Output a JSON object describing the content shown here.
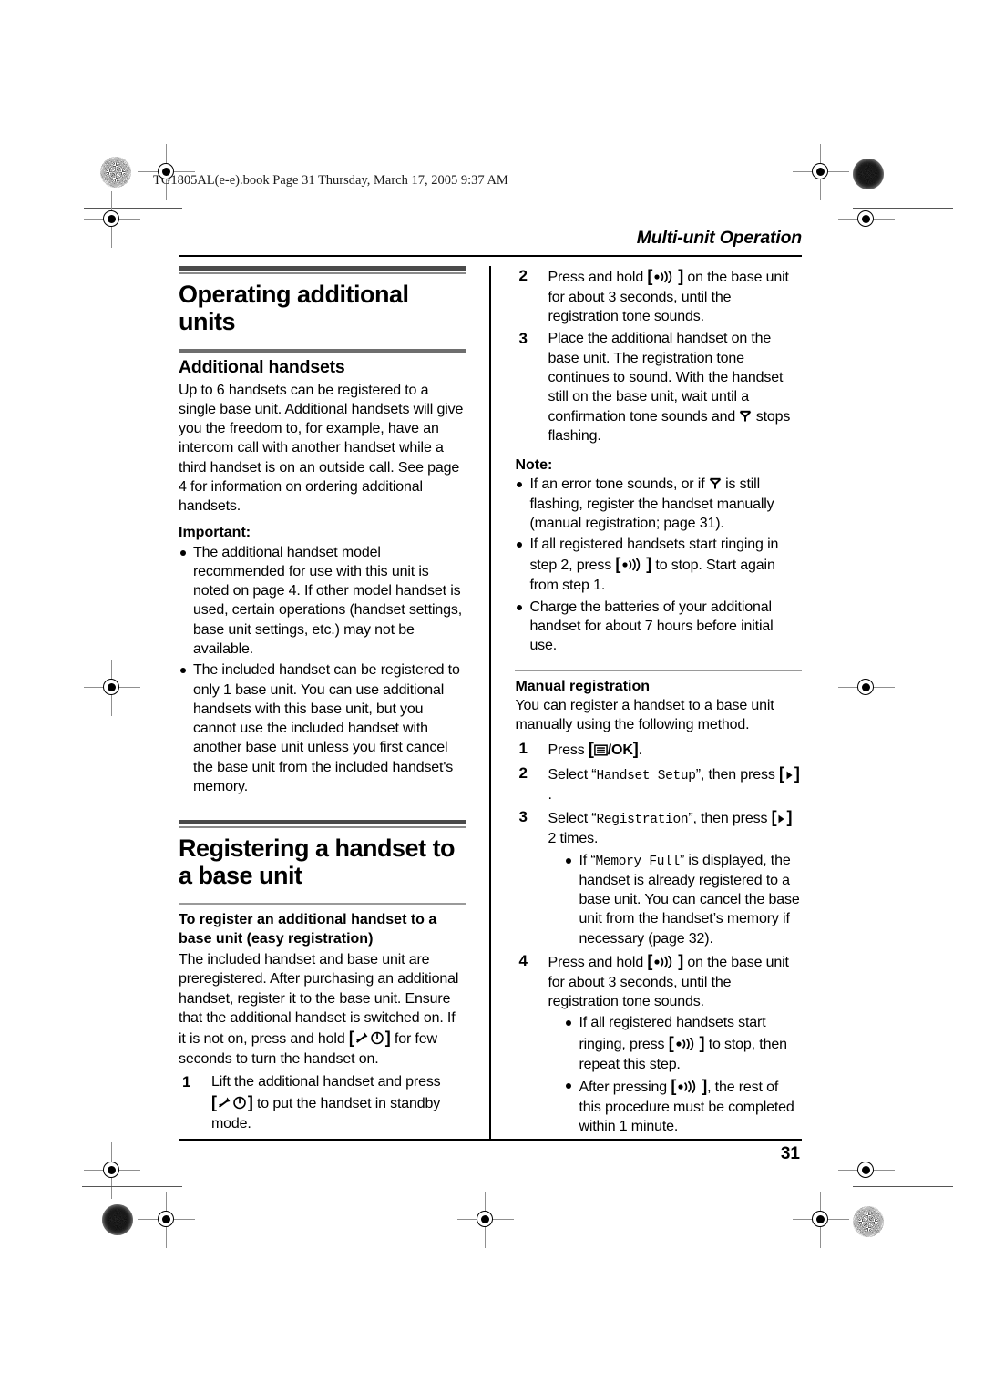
{
  "printmark": {
    "filestamp": "TG1805AL(e-e).book  Page 31  Thursday, March 17, 2005  9:37 AM"
  },
  "page": {
    "running_head": "Multi-unit Operation",
    "page_number": "31"
  },
  "icons": {
    "pager": "pager-speaker-icon",
    "antenna": "antenna-signal-icon",
    "power_off": "phone-off-power-icon",
    "menu_ok": "menu-ok-icon",
    "right_arrow": "right-arrow-icon",
    "registration_target": "registration-target-icon",
    "starburst": "starburst-density-icon"
  },
  "left_column": {
    "chapter_title": "Operating additional units",
    "section_1": {
      "heading": "Additional handsets",
      "paragraph": "Up to 6 handsets can be registered to a single base unit. Additional handsets will give you the freedom to, for example, have an intercom call with another handset while a third handset is on an outside call. See page 4 for information on ordering additional handsets.",
      "important_label": "Important:",
      "important_bullets": [
        "The additional handset model recommended for use with this unit is noted on page 4. If other model handset is used, certain operations (handset settings, base unit settings, etc.) may not be available.",
        "The included handset can be registered to only 1 base unit. You can use additional handsets with this base unit, but you cannot use the included handset with another base unit unless you first cancel the base unit from the included handset's memory."
      ]
    },
    "section_2": {
      "chapter_title": "Registering a handset to a base unit",
      "subheading": "To register an additional handset to a base unit (easy registration)",
      "paragraph_a": "The included handset and base unit are preregistered. After purchasing an additional handset, register it to the base unit. Ensure that the additional handset is switched on. If it is not on, press and hold ",
      "paragraph_b": " for few seconds to turn the handset on.",
      "step1_num": "1",
      "step1_a": "Lift the additional handset and press ",
      "step1_b": " to put the handset in standby mode."
    }
  },
  "right_column": {
    "step2_num": "2",
    "step2_a": "Press and hold ",
    "step2_b": " on the base unit for about 3 seconds, until the registration tone sounds.",
    "step3_num": "3",
    "step3_a": "Place the additional handset on the base unit. The registration tone continues to sound. With the handset still on the base unit, wait until a confirmation tone sounds and ",
    "step3_b": " stops flashing.",
    "note_label": "Note:",
    "note_1a": "If an error tone sounds, or if ",
    "note_1b": " is still flashing, register the handset manually (manual registration; page 31).",
    "note_2a": "If all registered handsets start ringing in step 2, press ",
    "note_2b": " to stop. Start again from step 1.",
    "note_3": "Charge the batteries of your additional handset for about 7 hours before initial use.",
    "manual": {
      "heading": "Manual registration",
      "paragraph": "You can register a handset to a base unit manually using the following method.",
      "step1_num": "1",
      "step1_a": "Press ",
      "step1_b": ".",
      "step2_num": "2",
      "step2_a": "Select “",
      "step2_display": "Handset Setup",
      "step2_b": "”, then press ",
      "step2_c": ".",
      "step3_num": "3",
      "step3_a": "Select “",
      "step3_display": "Registration",
      "step3_b": "”, then press ",
      "step3_c": " 2 times.",
      "step3_bullet_a": "If “",
      "step3_bullet_display": "Memory Full",
      "step3_bullet_b": "” is displayed, the handset is already registered to a base unit. You can cancel the base unit from the handset’s memory if necessary (page 32).",
      "step4_num": "4",
      "step4_a": "Press and hold ",
      "step4_b": " on the base unit for about 3 seconds, until the registration tone sounds.",
      "step4_bullet1_a": "If all registered handsets start ringing, press ",
      "step4_bullet1_b": " to stop, then repeat this step.",
      "step4_bullet2_a": "After pressing ",
      "step4_bullet2_b": ", the rest of this procedure must be completed within 1 minute."
    }
  }
}
